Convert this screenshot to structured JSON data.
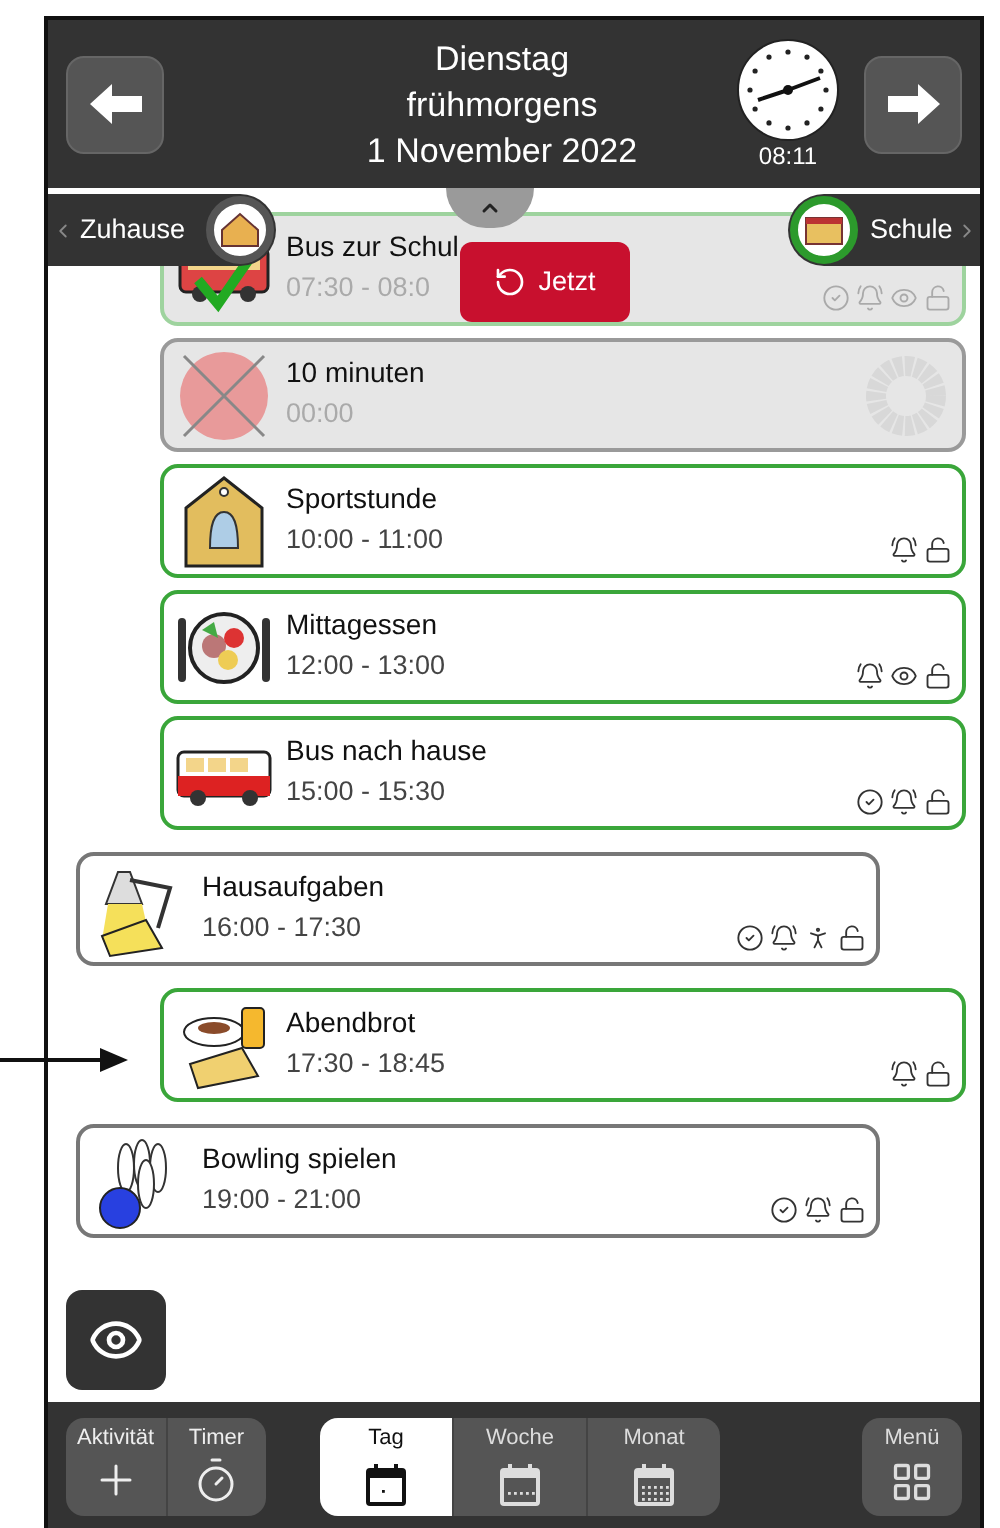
{
  "header": {
    "day": "Dienstag",
    "period": "frühmorgens",
    "date": "1 November 2022",
    "clock_time": "08:11"
  },
  "timeline": {
    "from": "Zuhause",
    "to": "Schule"
  },
  "now_button": "Jetzt",
  "activities": [
    {
      "kind": "activity",
      "title": "Bus zur Schul",
      "time": "07:30 - 08:0",
      "past": true,
      "indented": true,
      "color": "#9ed39e",
      "status_icons": [
        {
          "kind": "check"
        },
        {
          "kind": "bell"
        },
        {
          "kind": "eye"
        },
        {
          "kind": "lock"
        }
      ]
    },
    {
      "kind": "timer",
      "title": "10 minuten",
      "time": "00:00",
      "past": true,
      "indented": true,
      "color": "#9a9a9a"
    },
    {
      "kind": "activity",
      "title": "Sportstunde",
      "time": "10:00 - 11:00",
      "past": false,
      "indented": true,
      "color": "#3aa63a",
      "status_icons": [
        {
          "kind": "bell"
        },
        {
          "kind": "lock"
        }
      ]
    },
    {
      "kind": "activity",
      "title": "Mittagessen",
      "time": "12:00 - 13:00",
      "past": false,
      "indented": true,
      "color": "#3aa63a",
      "status_icons": [
        {
          "kind": "bell"
        },
        {
          "kind": "eye"
        },
        {
          "kind": "lock"
        }
      ]
    },
    {
      "kind": "activity",
      "title": "Bus nach hause",
      "time": "15:00 - 15:30",
      "past": false,
      "indented": true,
      "color": "#3aa63a",
      "status_icons": [
        {
          "kind": "check"
        },
        {
          "kind": "bell"
        },
        {
          "kind": "lock"
        }
      ]
    },
    {
      "kind": "activity",
      "title": "Hausaufgaben",
      "time": "16:00 - 17:30",
      "past": false,
      "indented": false,
      "color": "#777777",
      "status_icons": [
        {
          "kind": "check"
        },
        {
          "kind": "bell"
        },
        {
          "kind": "person"
        },
        {
          "kind": "lock"
        }
      ]
    },
    {
      "kind": "activity",
      "title": "Abendbrot",
      "time": "17:30 - 18:45",
      "past": false,
      "indented": true,
      "color": "#3aa63a",
      "status_icons": [
        {
          "kind": "bell"
        },
        {
          "kind": "lock"
        }
      ]
    },
    {
      "kind": "activity",
      "title": "Bowling spielen",
      "time": "19:00 - 21:00",
      "past": false,
      "indented": false,
      "color": "#777777",
      "status_icons": [
        {
          "kind": "check"
        },
        {
          "kind": "bell"
        },
        {
          "kind": "lock"
        }
      ]
    }
  ],
  "bottom_bar": {
    "create": [
      {
        "kind": "activity",
        "label": "Aktivität"
      },
      {
        "kind": "timer",
        "label": "Timer"
      }
    ],
    "views": [
      {
        "kind": "day",
        "label": "Tag",
        "selected": true
      },
      {
        "kind": "week",
        "label": "Woche",
        "selected": false
      },
      {
        "kind": "month",
        "label": "Monat",
        "selected": false
      }
    ],
    "menu": "Menü"
  }
}
